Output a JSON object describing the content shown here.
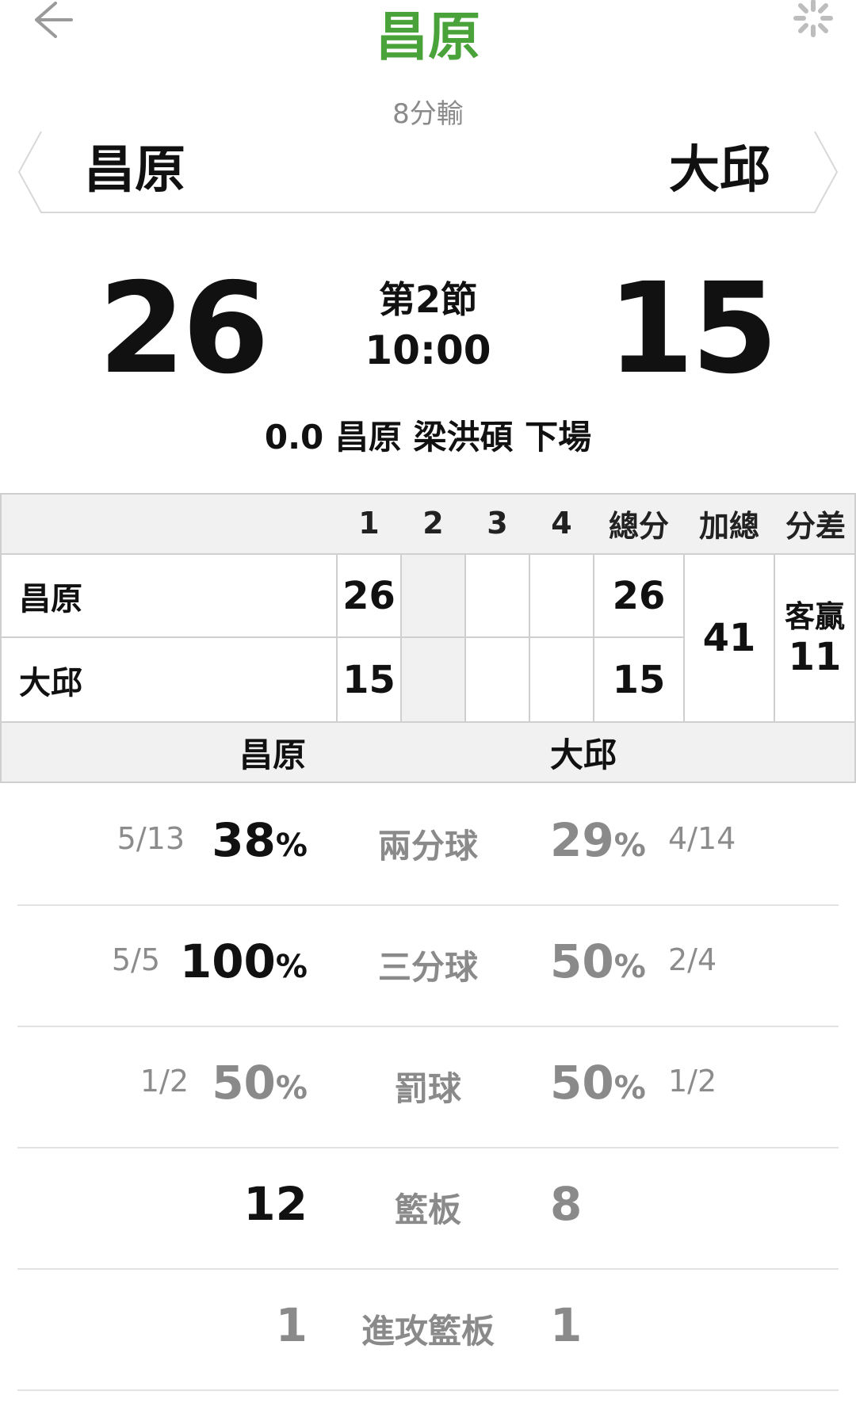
{
  "header": {
    "title": "昌原",
    "subtitle": "8分輸",
    "back_icon": "arrow-left-icon",
    "loading_icon": "spinner-icon"
  },
  "teams": {
    "home": "昌原",
    "away": "大邱"
  },
  "score": {
    "home": "26",
    "away": "15",
    "period": "第2節",
    "clock": "10:00"
  },
  "event_text": "0.0 昌原 梁洪碩 下場",
  "quarter_table": {
    "headers": [
      "1",
      "2",
      "3",
      "4",
      "總分",
      "加總",
      "分差"
    ],
    "rows": [
      {
        "team": "昌原",
        "q1": "26",
        "q2": "",
        "q3": "",
        "q4": "",
        "total": "26"
      },
      {
        "team": "大邱",
        "q1": "15",
        "q2": "",
        "q3": "",
        "q4": "",
        "total": "15"
      }
    ],
    "sum": "41",
    "diff_label": "客贏",
    "diff_value": "11"
  },
  "stats": {
    "header_home": "昌原",
    "header_away": "大邱",
    "rows": [
      {
        "label": "兩分球",
        "home_frac": "5/13",
        "home_pct": "38",
        "away_pct": "29",
        "away_frac": "4/14"
      },
      {
        "label": "三分球",
        "home_frac": "5/5",
        "home_pct": "100",
        "away_pct": "50",
        "away_frac": "2/4"
      },
      {
        "label": "罰球",
        "home_frac": "1/2",
        "home_pct": "50",
        "away_pct": "50",
        "away_frac": "1/2"
      },
      {
        "label": "籃板",
        "home_val": "12",
        "away_val": "8"
      },
      {
        "label": "進攻籃板",
        "home_val": "1",
        "away_val": "1"
      }
    ],
    "pct_symbol": "%"
  },
  "colors": {
    "accent": "#4aa33a",
    "muted": "#8a8a8a",
    "table_bg": "#f1f1f1"
  }
}
